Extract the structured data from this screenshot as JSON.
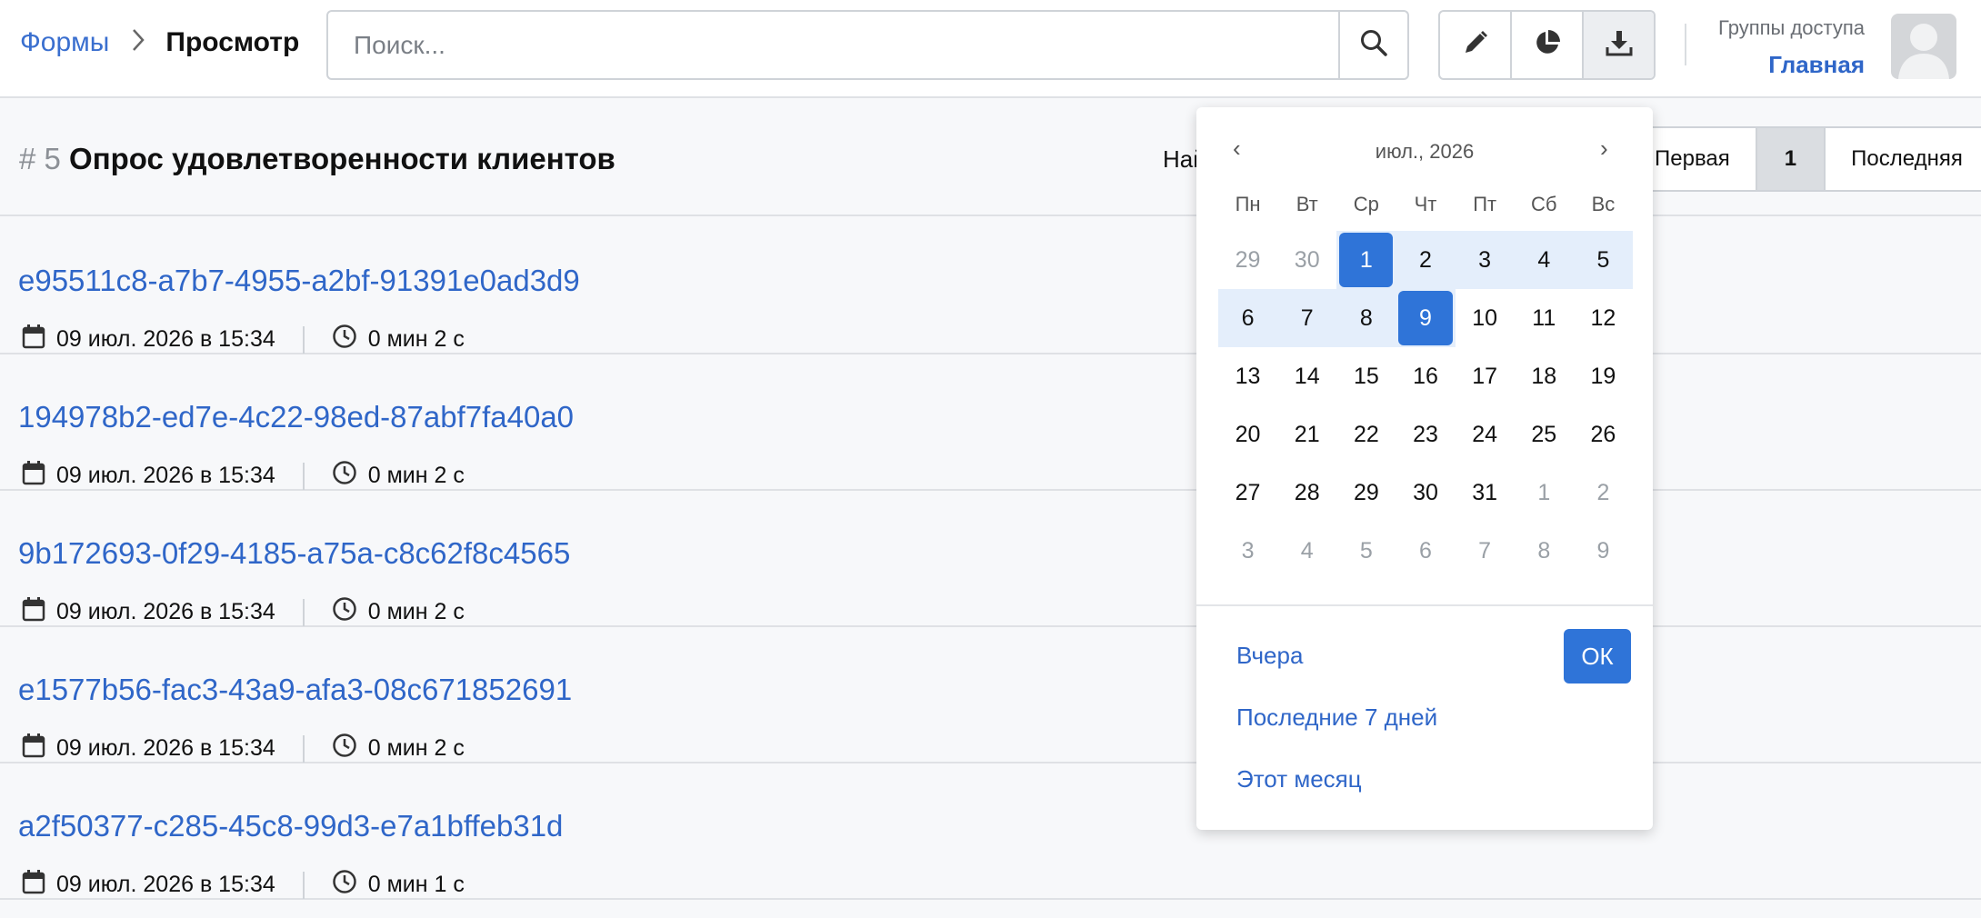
{
  "header": {
    "breadcrumb": {
      "root": "Формы",
      "current": "Просмотр"
    },
    "search": {
      "placeholder": "Поиск..."
    },
    "tools": {
      "edit": "pencil-icon",
      "stats": "pie-chart-icon",
      "download": "download-icon"
    },
    "access": {
      "label": "Группы доступа",
      "value": "Главная"
    }
  },
  "title": {
    "number": "# 5",
    "name": "Опрос удовлетворенности клиентов",
    "found_prefix": "Най"
  },
  "pagination": {
    "first": "Первая",
    "current": "1",
    "last": "Последняя"
  },
  "responses": [
    {
      "id": "e95511c8-a7b7-4955-a2bf-91391e0ad3d9",
      "date": "09 июл. 2026 в 15:34",
      "duration": "0 мин 2 с"
    },
    {
      "id": "194978b2-ed7e-4c22-98ed-87abf7fa40a0",
      "date": "09 июл. 2026 в 15:34",
      "duration": "0 мин 2 с"
    },
    {
      "id": "9b172693-0f29-4185-a75a-c8c62f8c4565",
      "date": "09 июл. 2026 в 15:34",
      "duration": "0 мин 2 с"
    },
    {
      "id": "e1577b56-fac3-43a9-afa3-08c671852691",
      "date": "09 июл. 2026 в 15:34",
      "duration": "0 мин 2 с"
    },
    {
      "id": "a2f50377-c285-45c8-99d3-e7a1bffeb31d",
      "date": "09 июл. 2026 в 15:34",
      "duration": "0 мин 1 с"
    }
  ],
  "datepicker": {
    "prev": "‹",
    "next": "›",
    "month": "июл., 2026",
    "weekdays": [
      "Пн",
      "Вт",
      "Ср",
      "Чт",
      "Пт",
      "Сб",
      "Вс"
    ],
    "days": [
      {
        "d": "29",
        "state": "muted"
      },
      {
        "d": "30",
        "state": "muted"
      },
      {
        "d": "1",
        "state": "sel"
      },
      {
        "d": "2",
        "state": "range"
      },
      {
        "d": "3",
        "state": "range"
      },
      {
        "d": "4",
        "state": "range"
      },
      {
        "d": "5",
        "state": "range"
      },
      {
        "d": "6",
        "state": "range"
      },
      {
        "d": "7",
        "state": "range"
      },
      {
        "d": "8",
        "state": "range"
      },
      {
        "d": "9",
        "state": "sel"
      },
      {
        "d": "10",
        "state": ""
      },
      {
        "d": "11",
        "state": ""
      },
      {
        "d": "12",
        "state": ""
      },
      {
        "d": "13",
        "state": ""
      },
      {
        "d": "14",
        "state": ""
      },
      {
        "d": "15",
        "state": ""
      },
      {
        "d": "16",
        "state": ""
      },
      {
        "d": "17",
        "state": ""
      },
      {
        "d": "18",
        "state": ""
      },
      {
        "d": "19",
        "state": ""
      },
      {
        "d": "20",
        "state": ""
      },
      {
        "d": "21",
        "state": ""
      },
      {
        "d": "22",
        "state": ""
      },
      {
        "d": "23",
        "state": ""
      },
      {
        "d": "24",
        "state": ""
      },
      {
        "d": "25",
        "state": ""
      },
      {
        "d": "26",
        "state": ""
      },
      {
        "d": "27",
        "state": ""
      },
      {
        "d": "28",
        "state": ""
      },
      {
        "d": "29",
        "state": ""
      },
      {
        "d": "30",
        "state": ""
      },
      {
        "d": "31",
        "state": ""
      },
      {
        "d": "1",
        "state": "muted"
      },
      {
        "d": "2",
        "state": "muted"
      },
      {
        "d": "3",
        "state": "muted"
      },
      {
        "d": "4",
        "state": "muted"
      },
      {
        "d": "5",
        "state": "muted"
      },
      {
        "d": "6",
        "state": "muted"
      },
      {
        "d": "7",
        "state": "muted"
      },
      {
        "d": "8",
        "state": "muted"
      },
      {
        "d": "9",
        "state": "muted"
      }
    ],
    "presets": {
      "yesterday": "Вчера",
      "last7": "Последние 7 дней",
      "month": "Этот месяц"
    },
    "ok": "ОК"
  },
  "colors": {
    "accent": "#2f74d8",
    "link": "#2f66c8",
    "range": "#e4eefb"
  }
}
